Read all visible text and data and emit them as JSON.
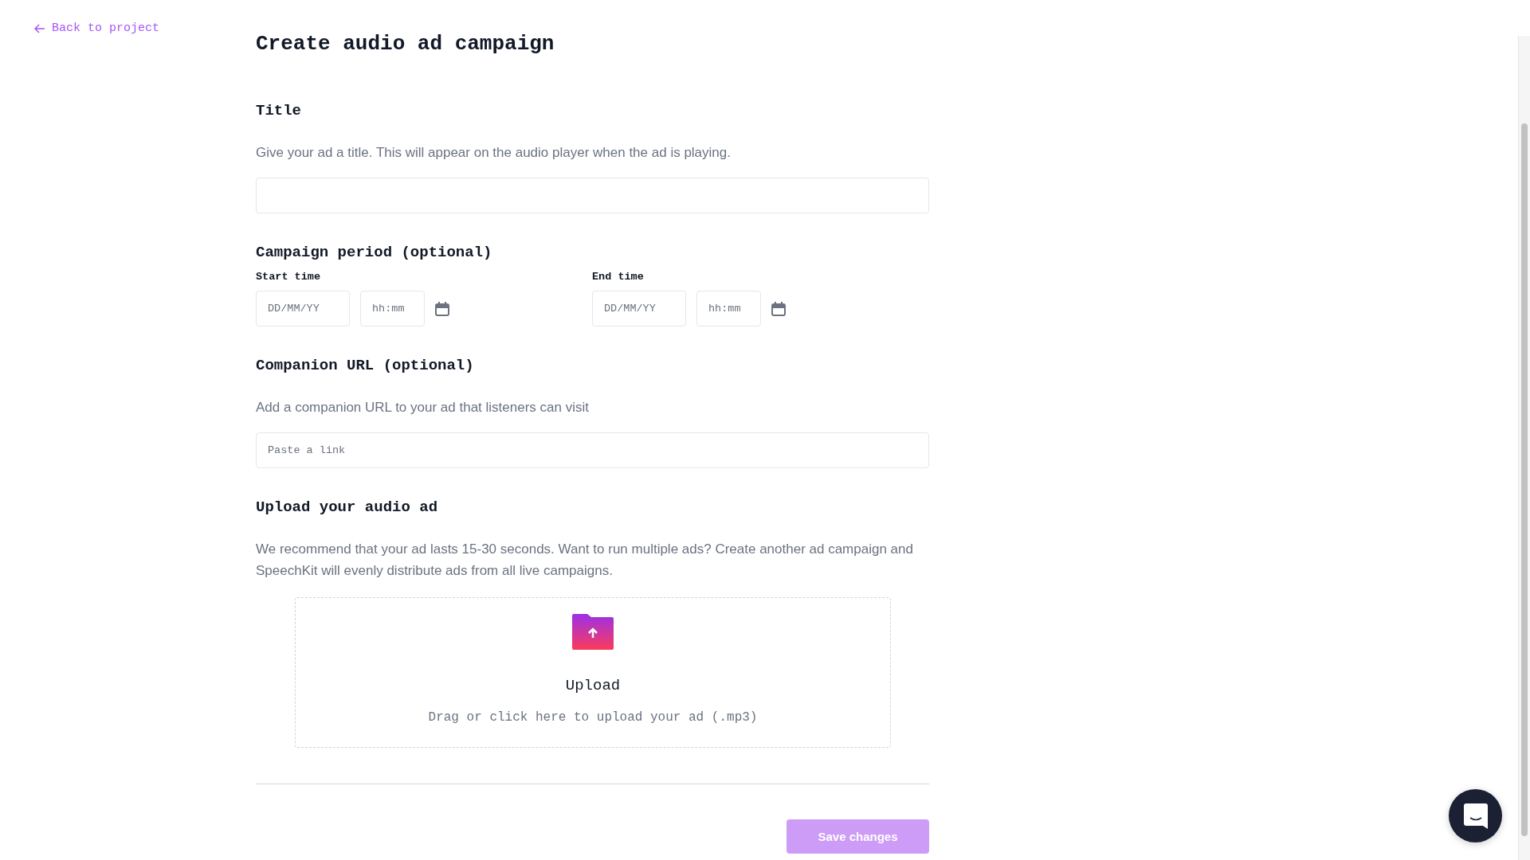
{
  "back_link": {
    "label": "Back to project"
  },
  "heading": "Create audio ad campaign",
  "title_section": {
    "heading": "Title",
    "description": "Give your ad a title. This will appear on the audio player when the ad is playing."
  },
  "campaign_period": {
    "heading": "Campaign period (optional)",
    "fields": [
      {
        "label": "Start time",
        "date_placeholder": "DD/MM/YY",
        "time_placeholder": "hh:mm"
      },
      {
        "label": "End time",
        "date_placeholder": "DD/MM/YY",
        "time_placeholder": "hh:mm"
      }
    ]
  },
  "companion_url": {
    "heading": "Companion URL (optional)",
    "description": "Add a companion URL to your ad that listeners can visit",
    "placeholder": "Paste a link"
  },
  "upload": {
    "heading": "Upload your audio ad",
    "description": "We recommend that your ad lasts 15-30 seconds. Want to run multiple ads? Create another ad campaign and SpeechKit will evenly distribute ads from all live campaigns.",
    "dropzone_title": "Upload",
    "dropzone_hint": "Drag or click here to upload your ad (.mp3)"
  },
  "save_button": {
    "label": "Save changes",
    "disabled": true
  }
}
